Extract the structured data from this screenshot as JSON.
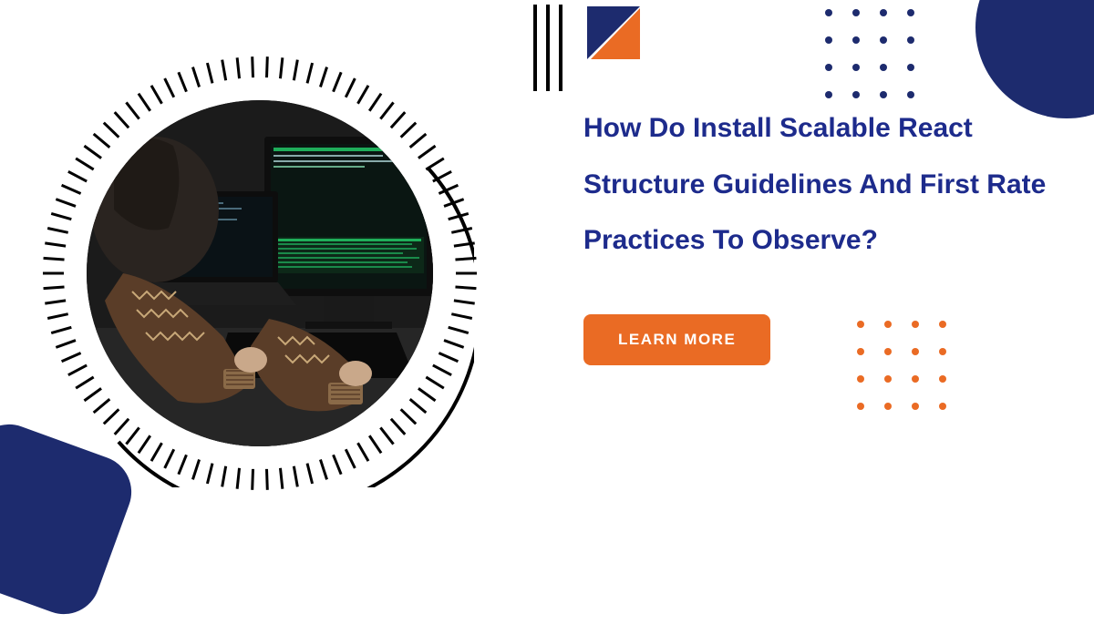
{
  "headline": {
    "text": "How Do Install Scalable React Structure Guidelines And First Rate Practices To Observe?"
  },
  "cta": {
    "label": "LEARN MORE"
  },
  "colors": {
    "navy": "#1d2b6e",
    "orange": "#ea6b24",
    "headline_blue": "#1d2b8c"
  },
  "decor": {
    "vbar_count": 3,
    "dots_top_grid": "4x4",
    "dots_bottom_grid": "4x4"
  },
  "image": {
    "alt": "Developer in patterned sweater typing on keyboard with laptop and large monitor showing code"
  }
}
